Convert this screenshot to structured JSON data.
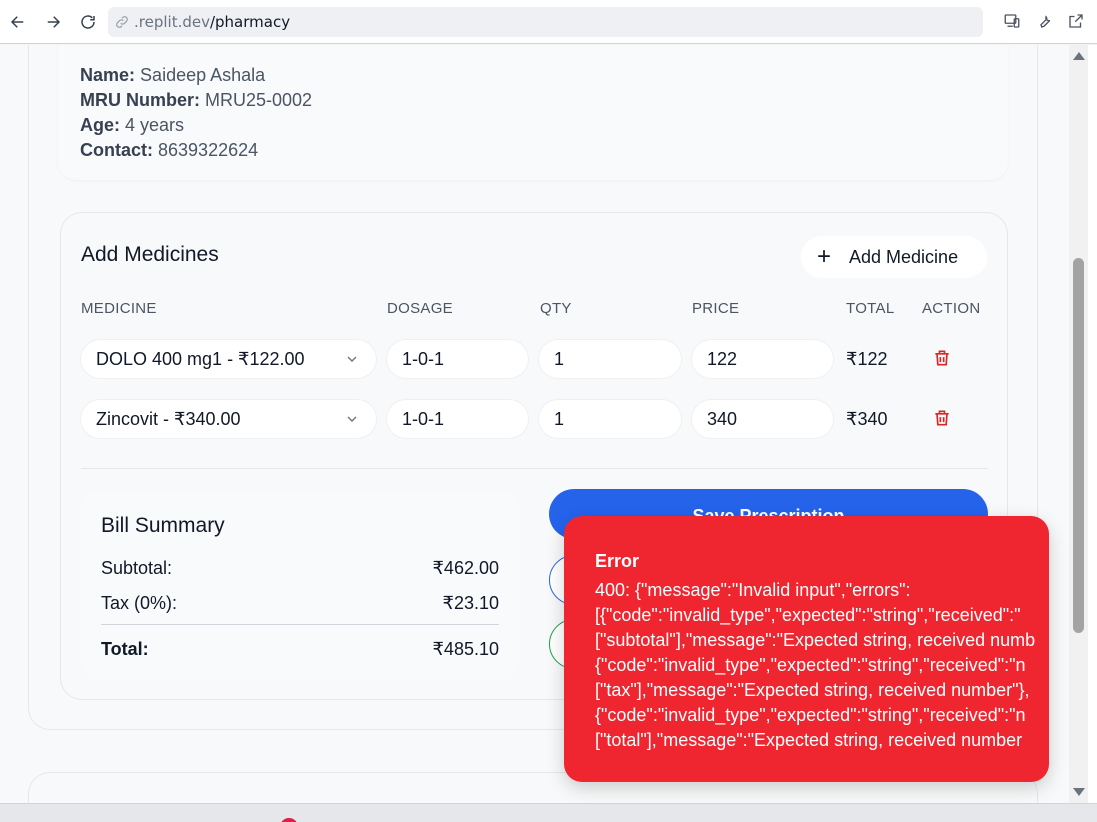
{
  "browser": {
    "url_domain": ".replit.dev",
    "url_path": "/pharmacy"
  },
  "patient": {
    "name_label": "Name:",
    "name_value": "Saideep Ashala",
    "mru_label": "MRU Number:",
    "mru_value": "MRU25-0002",
    "age_label": "Age:",
    "age_value": "4 years",
    "contact_label": "Contact:",
    "contact_value": "8639322624"
  },
  "medicines": {
    "title": "Add Medicines",
    "add_button": "Add Medicine",
    "columns": [
      "MEDICINE",
      "DOSAGE",
      "QTY",
      "PRICE",
      "TOTAL",
      "ACTION"
    ],
    "rows": [
      {
        "medicine": "DOLO 400 mg1 - ₹122.00",
        "dosage": "1-0-1",
        "qty": "1",
        "price": "122",
        "total": "₹122"
      },
      {
        "medicine": "Zincovit - ₹340.00",
        "dosage": "1-0-1",
        "qty": "1",
        "price": "340",
        "total": "₹340"
      }
    ]
  },
  "bill": {
    "title": "Bill Summary",
    "subtotal_label": "Subtotal:",
    "subtotal_value": "₹462.00",
    "tax_label": "Tax (0%):",
    "tax_value": "₹23.10",
    "total_label": "Total:",
    "total_value": "₹485.10"
  },
  "actions": {
    "save_label": "Save Prescription"
  },
  "toast": {
    "title": "Error",
    "lines": [
      "400: {\"message\":\"Invalid input\",\"errors\":",
      "[{\"code\":\"invalid_type\",\"expected\":\"string\",\"received\":\"",
      "[\"subtotal\"],\"message\":\"Expected string, received numb",
      "{\"code\":\"invalid_type\",\"expected\":\"string\",\"received\":\"n",
      "[\"tax\"],\"message\":\"Expected string, received number\"},",
      "{\"code\":\"invalid_type\",\"expected\":\"string\",\"received\":\"n",
      "[\"total\"],\"message\":\"Expected string, received number"
    ]
  },
  "colors": {
    "primary": "#2563eb",
    "error": "#ef2530",
    "delete": "#dc2626",
    "success_border": "#16a34a"
  }
}
